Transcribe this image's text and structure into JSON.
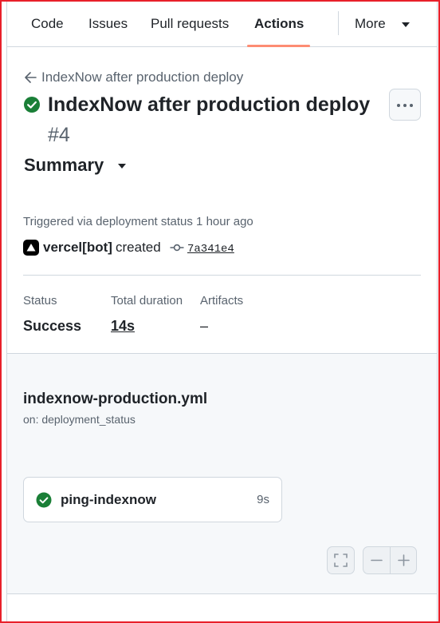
{
  "tabs": [
    {
      "label": "Code",
      "active": false
    },
    {
      "label": "Issues",
      "active": false
    },
    {
      "label": "Pull requests",
      "active": false
    },
    {
      "label": "Actions",
      "active": true
    },
    {
      "label": "More",
      "active": false
    }
  ],
  "header": {
    "back_label": "IndexNow after production deploy",
    "run_title": "IndexNow after production deploy",
    "run_number": "#4",
    "status_icon": "check-circle-fill-icon",
    "menu_icon": "kebab-horizontal-icon"
  },
  "summary_label": "Summary",
  "trigger": {
    "text": "Triggered via deployment status 1 hour ago",
    "actor": "vercel[bot]",
    "action": "created",
    "commit": "7a341e4"
  },
  "stats": {
    "status_label": "Status",
    "status_value": "Success",
    "duration_label": "Total duration",
    "duration_value": "14s",
    "artifacts_label": "Artifacts",
    "artifacts_value": "–"
  },
  "workflow": {
    "file": "indexnow-production.yml",
    "on": "on: deployment_status",
    "jobs": [
      {
        "name": "ping-indexnow",
        "duration": "9s",
        "status": "success"
      }
    ]
  },
  "colors": {
    "success": "#1a7f37",
    "tab_underline": "#fd8c73",
    "muted": "#59636e"
  }
}
